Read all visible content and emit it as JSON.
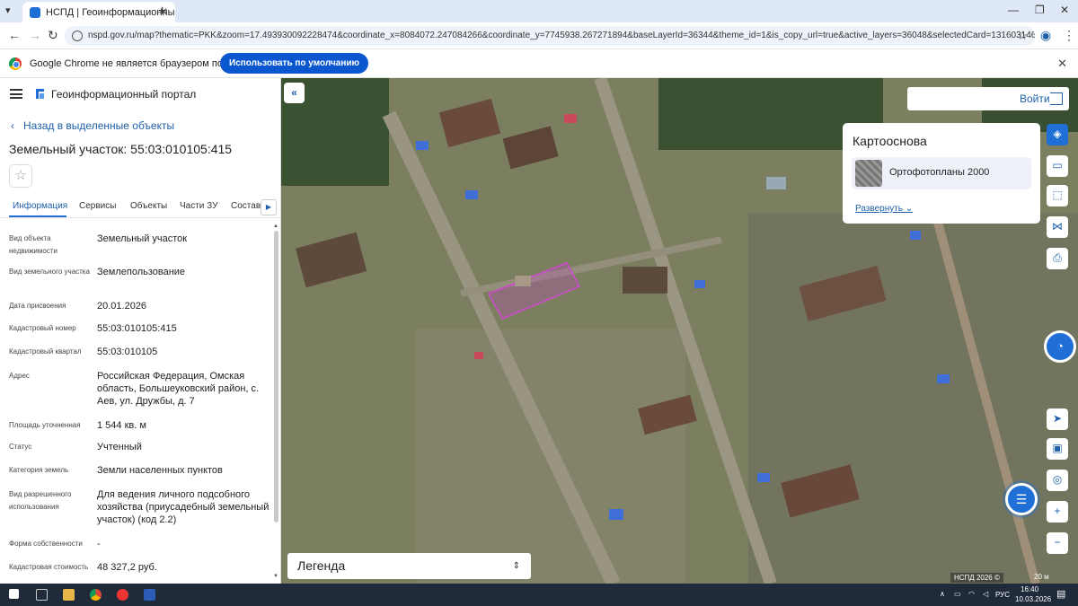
{
  "browser": {
    "tab_title": "НСПД | Геоинформационны",
    "url": "nspd.gov.ru/map?thematic=PKK&zoom=17.493930092228474&coordinate_x=8084072.247084266&coordinate_y=7745938.267271894&baseLayerId=36344&theme_id=1&is_copy_url=true&active_layers=36048&selectedCard=1316031465%2C36368%2C55%3A0...",
    "infobar_text": "Google Chrome не является браузером по умолчанию.",
    "infobar_button": "Использовать по умолчанию"
  },
  "sidebar": {
    "portal_title": "Геоинформационный портал",
    "back_link": "Назад в выделенные объекты",
    "object_title": "Земельный участок: 55:03:010105:415",
    "tabs": [
      {
        "label": "Информация"
      },
      {
        "label": "Сервисы"
      },
      {
        "label": "Объекты"
      },
      {
        "label": "Части ЗУ"
      },
      {
        "label": "Состав"
      }
    ],
    "fields": [
      {
        "label": "Вид объекта недвижимости",
        "value": "Земельный участок"
      },
      {
        "label": "Вид земельного участка",
        "value": "Землепользование"
      },
      {
        "label": "Дата присвоения",
        "value": "20.01.2026"
      },
      {
        "label": "Кадастровый номер",
        "value": "55:03:010105:415"
      },
      {
        "label": "Кадастровый квартал",
        "value": "55:03:010105"
      },
      {
        "label": "Адрес",
        "value": "Российская Федерация, Омская область, Большеуковский район, с. Аев, ул. Дружбы, д. 7"
      },
      {
        "label": "Площадь уточненная",
        "value": "1 544 кв. м"
      },
      {
        "label": "Статус",
        "value": "Учтенный"
      },
      {
        "label": "Категория земель",
        "value": "Земли населенных пунктов"
      },
      {
        "label": "Вид разрешенного использования",
        "value": "Для ведения личного подсобного хозяйства (приусадебный земельный участок) (код 2.2)"
      },
      {
        "label": "Форма собственности",
        "value": "-"
      },
      {
        "label": "Кадастровая стоимость",
        "value": "48 327,2 руб."
      }
    ]
  },
  "map": {
    "login": "Войти",
    "basemap_title": "Картооснова",
    "basemap_item": "Ортофотопланы 2000",
    "basemap_expand": "Развернуть",
    "legend": "Легенда",
    "copyright": "НСПД 2026 ©",
    "scale": "20 м"
  },
  "taskbar": {
    "lang": "РУС",
    "time": "16:40",
    "date": "10.03.2026"
  }
}
